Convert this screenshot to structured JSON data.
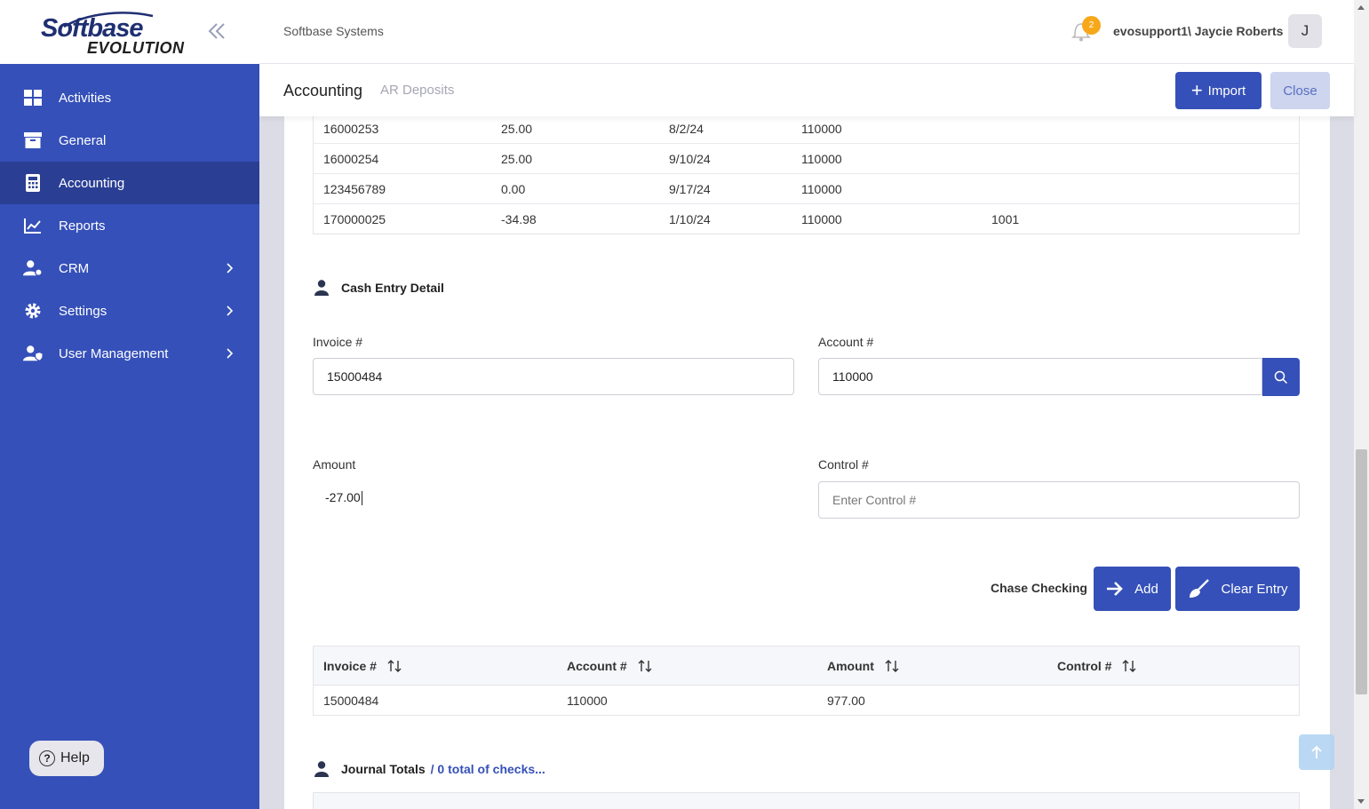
{
  "logo": {
    "line1": "Softbase",
    "line2": "EVOLUTION"
  },
  "sidebar": {
    "items": [
      {
        "label": "Activities",
        "icon": "grid-icon",
        "active": false,
        "has_children": false
      },
      {
        "label": "General",
        "icon": "archive-icon",
        "active": false,
        "has_children": false
      },
      {
        "label": "Accounting",
        "icon": "calculator-icon",
        "active": true,
        "has_children": false
      },
      {
        "label": "Reports",
        "icon": "chart-line-icon",
        "active": false,
        "has_children": false
      },
      {
        "label": "CRM",
        "icon": "users-cog-icon",
        "active": false,
        "has_children": true
      },
      {
        "label": "Settings",
        "icon": "gear-icon",
        "active": false,
        "has_children": true
      },
      {
        "label": "User Management",
        "icon": "user-shield-icon",
        "active": false,
        "has_children": true
      }
    ],
    "help_label": "Help"
  },
  "header": {
    "company": "Softbase Systems",
    "notification_count": "2",
    "user": "evosupport1\\ Jaycie Roberts",
    "avatar_initial": "J"
  },
  "subheader": {
    "crumb_main": "Accounting",
    "crumb_sub": "AR Deposits",
    "import_label": "Import",
    "close_label": "Close"
  },
  "top_table": {
    "rows": [
      {
        "c1": "16000253",
        "c2": "25.00",
        "c3": "8/2/24",
        "c4": "110000",
        "c5": ""
      },
      {
        "c1": "16000254",
        "c2": "25.00",
        "c3": "9/10/24",
        "c4": "110000",
        "c5": ""
      },
      {
        "c1": "123456789",
        "c2": "0.00",
        "c3": "9/17/24",
        "c4": "110000",
        "c5": ""
      },
      {
        "c1": "170000025",
        "c2": "-34.98",
        "c3": "1/10/24",
        "c4": "110000",
        "c5": "1001"
      }
    ]
  },
  "cash_entry": {
    "title": "Cash Entry Detail",
    "invoice_label": "Invoice #",
    "invoice_value": "15000484",
    "account_label": "Account #",
    "account_value": "110000",
    "amount_label": "Amount",
    "amount_value": "-27.00",
    "control_label": "Control #",
    "control_placeholder": "Enter Control #",
    "bank_name": "Chase Checking",
    "add_label": "Add",
    "clear_label": "Clear Entry"
  },
  "entries_table": {
    "headers": [
      "Invoice #",
      "Account #",
      "Amount",
      "Control #"
    ],
    "rows": [
      {
        "invoice": "15000484",
        "account": "110000",
        "amount": "977.00",
        "control": ""
      }
    ]
  },
  "journal": {
    "title": "Journal Totals",
    "subtitle": "/ 0 total of checks..."
  },
  "colors": {
    "primary": "#3550b8",
    "sidebar_active": "#2a3f94",
    "badge": "#f6a81a"
  }
}
